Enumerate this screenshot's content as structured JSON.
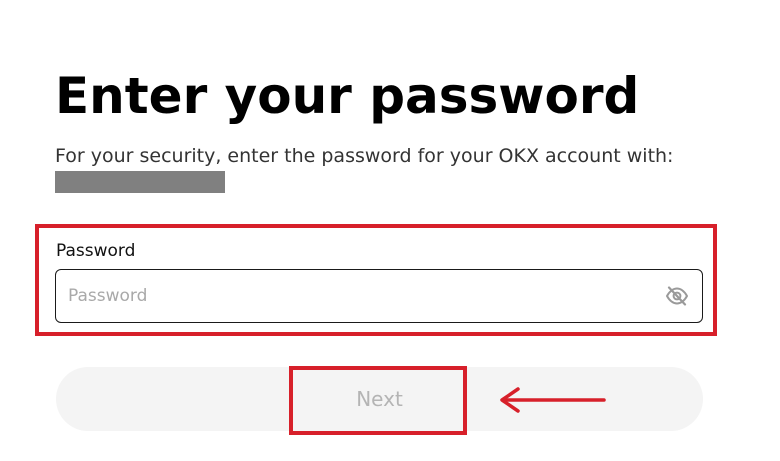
{
  "header": {
    "title": "Enter your password",
    "subtitle": "For your security, enter the password for your OKX account with:"
  },
  "form": {
    "password_label": "Password",
    "password_placeholder": "Password",
    "password_value": "",
    "visibility_icon": "eye-slash-icon",
    "next_label": "Next",
    "next_disabled": true
  },
  "annotations": {
    "highlight_color": "#d7202a",
    "arrow_direction": "left"
  },
  "colors": {
    "redaction": "#808080",
    "button_bg": "#f4f4f4",
    "button_text": "#b4b4b4"
  }
}
